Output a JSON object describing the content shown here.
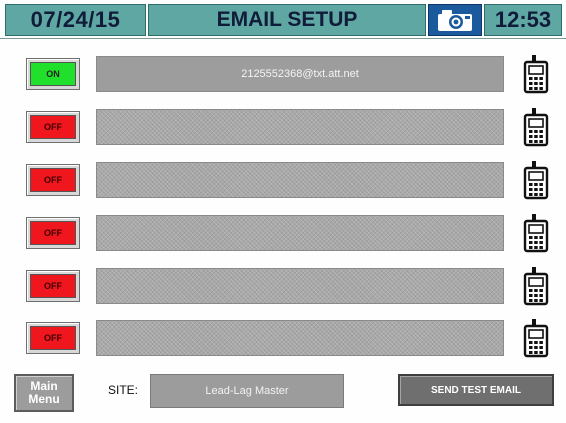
{
  "header": {
    "date": "07/24/15",
    "title": "EMAIL SETUP",
    "camera_icon": "camera-icon",
    "time": "12:53"
  },
  "colors": {
    "header_bg": "#5fa7a3",
    "header_text": "#101c3a",
    "camera_bg": "#1c5a9e",
    "toggle_on": "#21e02c",
    "toggle_off": "#f0161d",
    "field_bg": "#9d9d9d"
  },
  "rows": [
    {
      "status": "ON",
      "address": "2125552368@txt.att.net",
      "icon": "cell-phone-icon"
    },
    {
      "status": "OFF",
      "address": "",
      "icon": "cell-phone-icon"
    },
    {
      "status": "OFF",
      "address": "",
      "icon": "cell-phone-icon"
    },
    {
      "status": "OFF",
      "address": "",
      "icon": "cell-phone-icon"
    },
    {
      "status": "OFF",
      "address": "",
      "icon": "cell-phone-icon"
    },
    {
      "status": "OFF",
      "address": "",
      "icon": "cell-phone-icon"
    }
  ],
  "footer": {
    "main_menu_label": "Main\nMenu",
    "site_label": "SITE:",
    "site_value": "Lead-Lag Master",
    "send_test_label": "SEND TEST EMAIL"
  }
}
